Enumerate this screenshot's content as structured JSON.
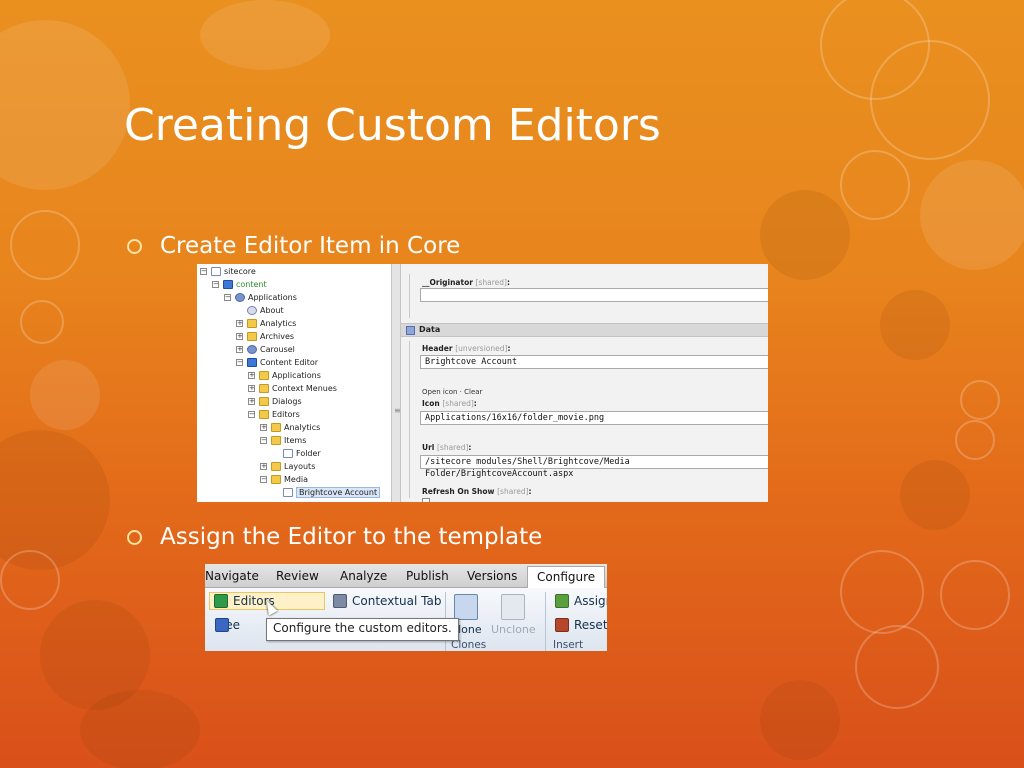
{
  "slide": {
    "title": "Creating Custom Editors",
    "bullets": [
      {
        "text": "Create Editor Item in Core"
      },
      {
        "text": "Assign the Editor to the template"
      }
    ]
  },
  "content_tree": {
    "nodes": [
      {
        "label": "sitecore",
        "toggle": "−",
        "icon": "page-icon"
      },
      {
        "label": "content",
        "toggle": "−",
        "icon": "content-icon"
      },
      {
        "label": "Applications",
        "toggle": "−",
        "icon": "app-icon"
      },
      {
        "label": "About",
        "toggle": "",
        "icon": "info-icon"
      },
      {
        "label": "Analytics",
        "toggle": "+",
        "icon": "folder-icon"
      },
      {
        "label": "Archives",
        "toggle": "+",
        "icon": "folder-icon"
      },
      {
        "label": "Carousel",
        "toggle": "+",
        "icon": "app-icon"
      },
      {
        "label": "Content Editor",
        "toggle": "−",
        "icon": "content-icon"
      },
      {
        "label": "Applications",
        "toggle": "+",
        "icon": "folder-icon"
      },
      {
        "label": "Context Menues",
        "toggle": "+",
        "icon": "folder-icon"
      },
      {
        "label": "Dialogs",
        "toggle": "+",
        "icon": "folder-icon"
      },
      {
        "label": "Editors",
        "toggle": "−",
        "icon": "folder-icon"
      },
      {
        "label": "Analytics",
        "toggle": "+",
        "icon": "folder-icon"
      },
      {
        "label": "Items",
        "toggle": "−",
        "icon": "folder-icon"
      },
      {
        "label": "Folder",
        "toggle": "",
        "icon": "page-icon"
      },
      {
        "label": "Layouts",
        "toggle": "+",
        "icon": "folder-icon"
      },
      {
        "label": "Media",
        "toggle": "−",
        "icon": "folder-icon"
      },
      {
        "label": "Brightcove Account",
        "toggle": "",
        "icon": "page-icon"
      }
    ]
  },
  "fields": {
    "originator": {
      "label": "__Originator",
      "meta": "[shared]",
      "colon": ":",
      "value": ""
    },
    "section": "Data",
    "header": {
      "label": "Header",
      "meta": "[unversioned]",
      "colon": ":",
      "value": "Brightcove Account"
    },
    "icon_links": "Open icon  ·  Clear",
    "icon": {
      "label": "Icon",
      "meta": "[shared]",
      "colon": ":",
      "value": "Applications/16x16/folder_movie.png"
    },
    "url": {
      "label": "Url",
      "meta": "[shared]",
      "colon": ":",
      "value": "/sitecore modules/Shell/Brightcove/Media Folder/BrightcoveAccount.aspx"
    },
    "refresh": {
      "label": "Refresh On Show",
      "meta": "[shared]",
      "colon": ":"
    }
  },
  "ribbon": {
    "tabs": [
      "Navigate",
      "Review",
      "Analyze",
      "Publish",
      "Versions",
      "Configure"
    ],
    "active_tab": "Configure",
    "buttons": {
      "editors": "Editors",
      "tree": "Tree",
      "contextual_tab": "Contextual Tab",
      "clone": "Clone",
      "unclone": "Unclone",
      "assign": "Assign",
      "reset": "Reset"
    },
    "groups": {
      "clones": "Clones",
      "insert_options": "Insert Opti"
    },
    "tooltip": "Configure the custom editors."
  },
  "colors": {
    "background_top": "#e9901f",
    "background_bottom": "#d9501a",
    "bullet": "#f8e3a0",
    "title": "#ffffff"
  }
}
